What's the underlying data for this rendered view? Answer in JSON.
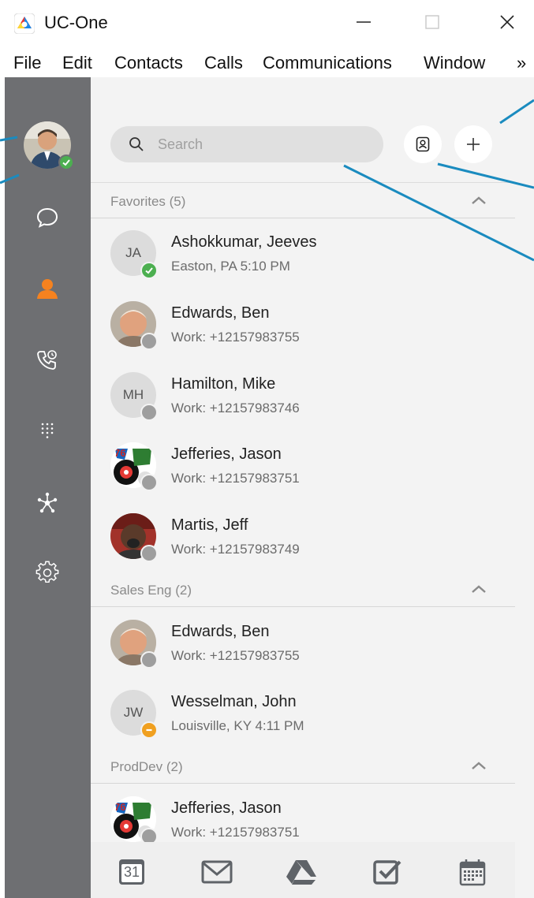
{
  "window": {
    "title": "UC-One",
    "controls": [
      "minimize-icon",
      "maximize-icon",
      "close-icon"
    ]
  },
  "menu": {
    "items": [
      "File",
      "Edit",
      "Contacts",
      "Calls",
      "Communications",
      "Window"
    ],
    "overflow": "»"
  },
  "rail": {
    "avatar_status": "available",
    "items": [
      {
        "icon": "chat-icon",
        "active": false
      },
      {
        "icon": "contacts-icon",
        "active": true
      },
      {
        "icon": "call-history-icon",
        "active": false
      },
      {
        "icon": "dialpad-icon",
        "active": false
      },
      {
        "icon": "meet-icon",
        "active": false
      },
      {
        "icon": "settings-icon",
        "active": false
      }
    ]
  },
  "search": {
    "placeholder": "Search"
  },
  "sections": [
    {
      "label": "Favorites (5)"
    },
    {
      "label": "Sales Eng (2)"
    },
    {
      "label": "ProdDev (2)"
    }
  ],
  "contacts": [
    {
      "name": "Ashokkumar, Jeeves",
      "status": "Easton, PA 5:10 PM",
      "initials": "JA",
      "presence": "available"
    },
    {
      "name": "Edwards, Ben",
      "status": "Work: +12157983755",
      "initials": "",
      "presence": "offline"
    },
    {
      "name": "Hamilton, Mike",
      "status": "Work: +12157983746",
      "initials": "MH",
      "presence": "offline"
    },
    {
      "name": "Jefferies, Jason",
      "status": "Work: +12157983751",
      "initials": "",
      "presence": "offline"
    },
    {
      "name": "Martis, Jeff",
      "status": "Work: +12157983749",
      "initials": "",
      "presence": "offline"
    },
    {
      "name": "Edwards, Ben",
      "status": "Work: +12157983755",
      "initials": "",
      "presence": "offline"
    },
    {
      "name": "Wesselman, John",
      "status": "Louisville, KY 4:11 PM",
      "initials": "JW",
      "presence": "busy"
    },
    {
      "name": "Jefferies, Jason",
      "status": "Work: +12157983751",
      "initials": "",
      "presence": "offline"
    }
  ],
  "bottom_bar": {
    "calendar_day": "31",
    "items": [
      "calendar-icon",
      "mail-icon",
      "drive-icon",
      "tasks-icon",
      "schedule-icon"
    ]
  },
  "colors": {
    "rail": "#6e6f72",
    "accent": "#f5821f",
    "available": "#4caf50",
    "busy": "#f0a020",
    "offline": "#9e9e9e",
    "callout": "#1a8bbf"
  }
}
